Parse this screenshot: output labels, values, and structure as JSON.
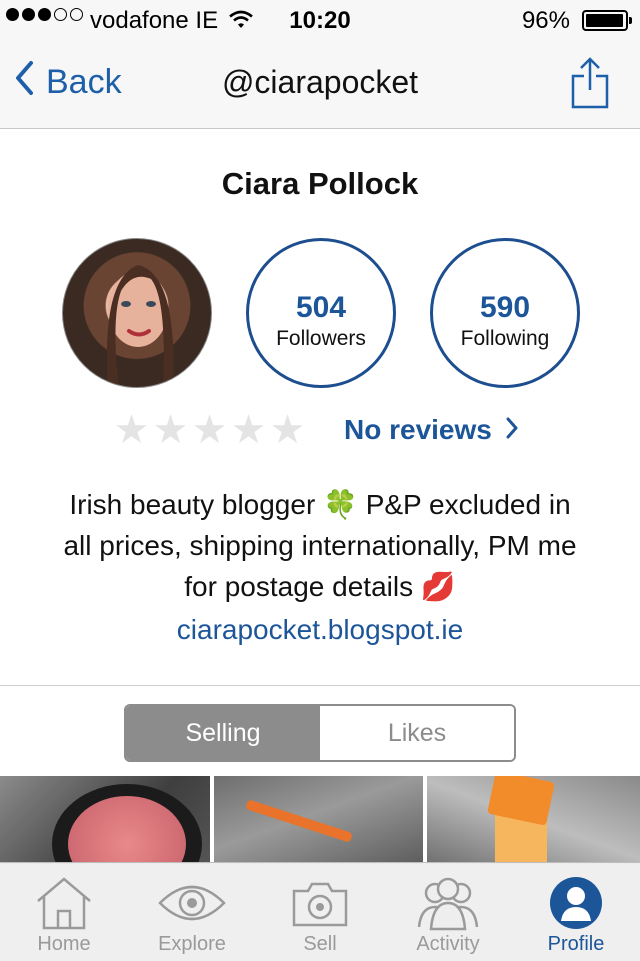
{
  "status_bar": {
    "carrier": "vodafone IE",
    "time": "10:20",
    "battery_percent": "96%",
    "signal_bars_filled": 3,
    "signal_bars_total": 5
  },
  "nav": {
    "back_label": "Back",
    "title": "@ciarapocket",
    "share_icon": "share-icon"
  },
  "profile": {
    "name": "Ciara Pollock",
    "followers_count": "504",
    "followers_label": "Followers",
    "following_count": "590",
    "following_label": "Following",
    "rating_stars_filled": 0,
    "rating_stars_total": 5,
    "reviews_label": "No reviews",
    "bio_line1": "Irish beauty blogger 🍀 P&P excluded in",
    "bio_line2": "all prices, shipping internationally, PM me",
    "bio_line3": "for postage details 💋",
    "website": "ciarapocket.blogspot.ie"
  },
  "segments": {
    "selling": "Selling",
    "likes": "Likes",
    "active": "selling"
  },
  "tabs": [
    {
      "label": "Home",
      "icon": "home-icon"
    },
    {
      "label": "Explore",
      "icon": "eye-icon"
    },
    {
      "label": "Sell",
      "icon": "camera-icon"
    },
    {
      "label": "Activity",
      "icon": "people-icon"
    },
    {
      "label": "Profile",
      "icon": "profile-icon"
    }
  ],
  "colors": {
    "accent": "#1d5599",
    "segment_active": "#8c8c8c",
    "tab_inactive": "#9a9a9a"
  }
}
